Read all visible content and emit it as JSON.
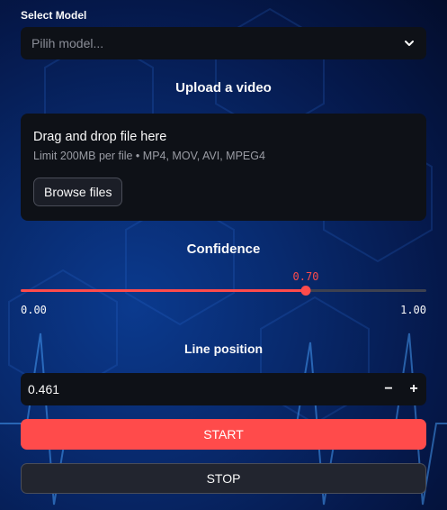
{
  "select_model": {
    "label": "Select Model",
    "placeholder": "Pilih model..."
  },
  "upload": {
    "title": "Upload a video",
    "drag_text": "Drag and drop file here",
    "limit_text": "Limit 200MB per file • MP4, MOV, AVI, MPEG4",
    "browse_label": "Browse files"
  },
  "confidence": {
    "title": "Confidence",
    "value": 0.7,
    "value_text": "0.70",
    "min_text": "0.00",
    "max_text": "1.00",
    "min": 0,
    "max": 1
  },
  "line_position": {
    "title": "Line position",
    "value": "0.461",
    "minus": "−",
    "plus": "+"
  },
  "buttons": {
    "start": "START",
    "stop": "STOP"
  },
  "colors": {
    "accent": "#ff4b4b",
    "widget_bg": "#0e1117"
  },
  "icons": {
    "select_chevron": "chevron-down-icon"
  }
}
